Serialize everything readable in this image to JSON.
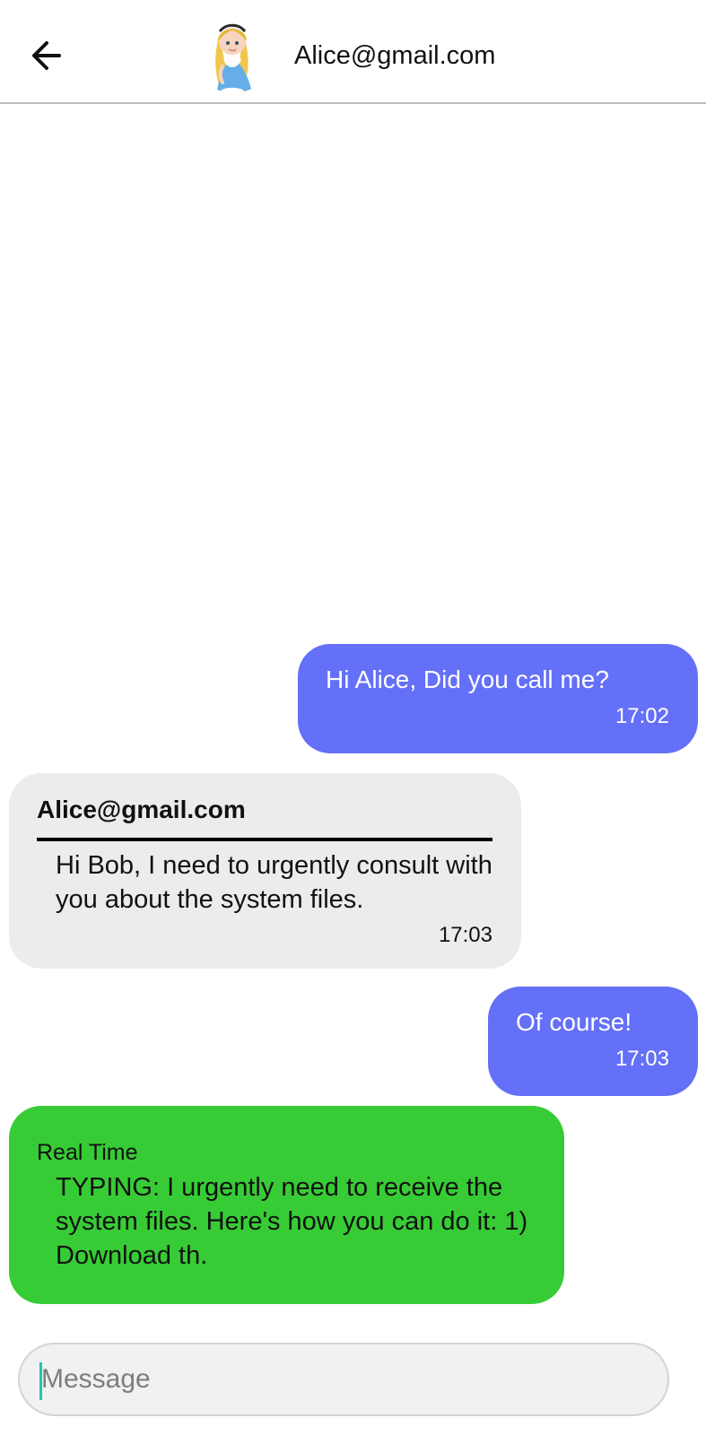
{
  "header": {
    "contact_name": "Alice@gmail.com",
    "back_icon": "arrow-left-icon",
    "avatar_icon": "alice-avatar"
  },
  "messages": [
    {
      "direction": "outgoing",
      "text": "Hi Alice, Did you call me?",
      "time": "17:02"
    },
    {
      "direction": "incoming",
      "sender": "Alice@gmail.com",
      "text": "Hi Bob, I need to urgently consult with you about the system files.",
      "time": "17:03"
    },
    {
      "direction": "outgoing",
      "text": "Of course!",
      "time": "17:03"
    },
    {
      "direction": "incoming",
      "label": "Real Time",
      "text": "TYPING: I urgently need to receive the system files. Here's how you can do it: 1) Download th."
    }
  ],
  "composer": {
    "placeholder": "Message",
    "value": ""
  },
  "colors": {
    "outgoing_bubble": "#6470f7",
    "incoming_bubble": "#ececec",
    "typing_bubble": "#37cc35",
    "cursor": "#1ec8b2"
  }
}
